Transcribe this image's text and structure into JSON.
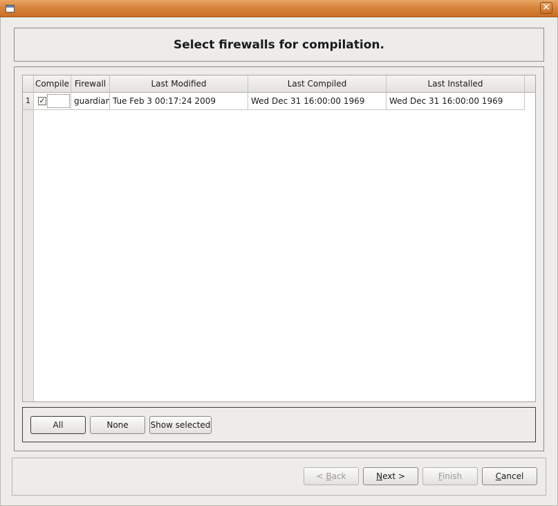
{
  "window": {
    "title": "",
    "close_glyph": "✕",
    "icon": "window-icon"
  },
  "header": {
    "title": "Select firewalls for compilation."
  },
  "table": {
    "columns": [
      "Compile",
      "Firewall",
      "Last Modified",
      "Last Compiled",
      "Last Installed"
    ],
    "rows": [
      {
        "num": "1",
        "compile_checked": "✓",
        "firewall": "guardian",
        "last_modified": "Tue Feb 3 00:17:24 2009",
        "last_compiled": "Wed Dec 31 16:00:00 1969",
        "last_installed": "Wed Dec 31 16:00:00 1969"
      }
    ]
  },
  "selection_buttons": {
    "all": "All",
    "none": "None",
    "show_selected": "Show selected"
  },
  "nav": {
    "back_prefix": "< ",
    "back_mnemonic": "B",
    "back_rest": "ack",
    "next_mnemonic": "N",
    "next_rest": "ext >",
    "finish_mnemonic": "F",
    "finish_rest": "inish",
    "cancel_mnemonic": "C",
    "cancel_rest": "ancel"
  }
}
